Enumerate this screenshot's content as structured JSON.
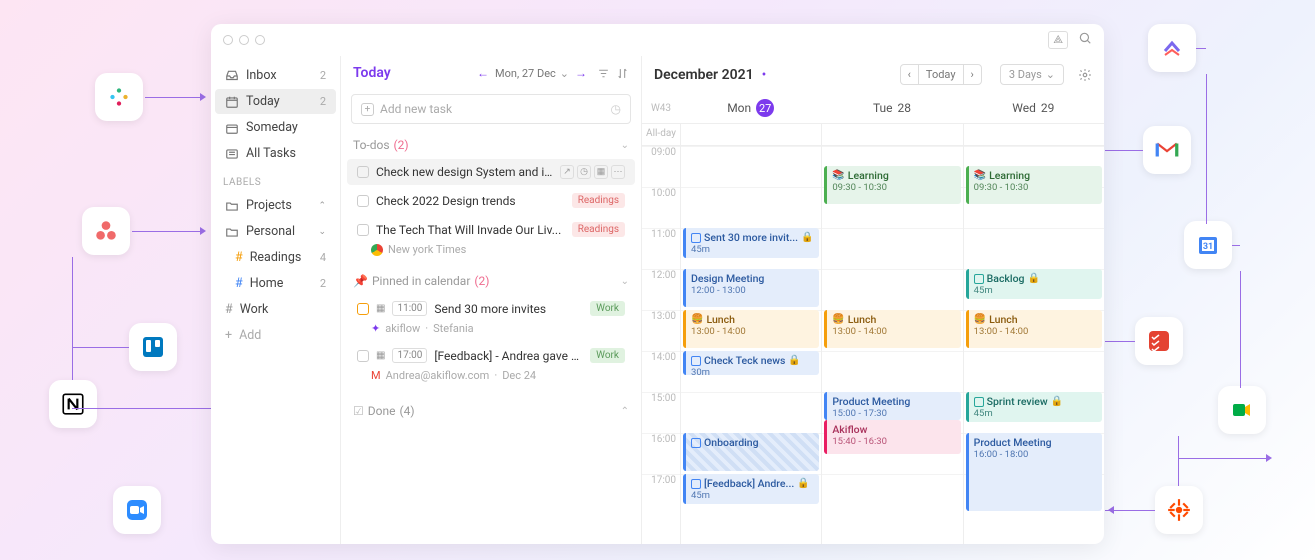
{
  "sidebar": {
    "inbox": {
      "label": "Inbox",
      "count": "2"
    },
    "today": {
      "label": "Today",
      "count": "2"
    },
    "someday": {
      "label": "Someday"
    },
    "alltasks": {
      "label": "All Tasks"
    },
    "labels_header": "LABELS",
    "projects": {
      "label": "Projects"
    },
    "personal": {
      "label": "Personal"
    },
    "readings": {
      "label": "Readings",
      "count": "4"
    },
    "home": {
      "label": "Home",
      "count": "2"
    },
    "work": {
      "label": "Work"
    },
    "add": {
      "label": "Add"
    }
  },
  "tasks": {
    "title": "Today",
    "date": "Mon, 27 Dec",
    "add_placeholder": "Add new task",
    "sections": {
      "todos": {
        "label": "To-dos",
        "count": "(2)"
      },
      "pinned": {
        "label": "Pinned in calendar",
        "count": "(2)"
      },
      "done": {
        "label": "Done",
        "count": "(4)"
      }
    },
    "items": {
      "t1": {
        "text": "Check new design System and improve..."
      },
      "t2": {
        "text": "Check 2022 Design trends",
        "badge": "Readings"
      },
      "t3": {
        "text": "The Tech That Will Invade Our Liv...",
        "badge": "Readings",
        "source": "New york Times"
      },
      "p1": {
        "time": "11:00",
        "text": "Send 30 more invites",
        "badge": "Work",
        "source": "akiflow",
        "source2": "Stefania"
      },
      "p2": {
        "time": "17:00",
        "text": "[Feedback] - Andrea gave you his fee...",
        "badge": "Work",
        "source": "Andrea@akiflow.com",
        "date": "Dec 24"
      }
    }
  },
  "calendar": {
    "title": "December 2021",
    "today_btn": "Today",
    "range": "3 Days",
    "week": "W43",
    "allday": "All-day",
    "days": [
      {
        "name": "Mon",
        "num": "27",
        "today": true
      },
      {
        "name": "Tue",
        "num": "28"
      },
      {
        "name": "Wed",
        "num": "29"
      }
    ],
    "hours": [
      "09:00",
      "10:00",
      "11:00",
      "12:00",
      "13:00",
      "14:00",
      "15:00",
      "16:00",
      "17:00"
    ],
    "events": {
      "learn1": {
        "title": "Learning",
        "time": "09:30 - 10:30",
        "emoji": "📚"
      },
      "learn2": {
        "title": "Learning",
        "time": "09:30 - 10:30",
        "emoji": "📚"
      },
      "sent30": {
        "title": "Sent 30 more invit...",
        "time": "45m"
      },
      "design": {
        "title": "Design Meeting",
        "time": "12:00 - 13:00"
      },
      "backlog": {
        "title": "Backlog",
        "time": "45m"
      },
      "lunch1": {
        "title": "Lunch",
        "time": "13:00 - 14:00",
        "emoji": "🍔"
      },
      "lunch2": {
        "title": "Lunch",
        "time": "13:00 - 14:00",
        "emoji": "🍔"
      },
      "lunch3": {
        "title": "Lunch",
        "time": "13:00 - 14:00",
        "emoji": "🍔"
      },
      "teck": {
        "title": "Check Teck news",
        "time": "30m"
      },
      "product1": {
        "title": "Product Meeting",
        "time": "15:00 - 17:30"
      },
      "akiflow": {
        "title": "Akiflow",
        "time": "15:40 - 16:30"
      },
      "sprint": {
        "title": "Sprint review",
        "time": "45m"
      },
      "onboard": {
        "title": "Onboarding"
      },
      "product2": {
        "title": "Product Meeting",
        "time": "16:00 - 18:00"
      },
      "feedback": {
        "title": "[Feedback] Andre...",
        "time": "45m"
      }
    }
  }
}
